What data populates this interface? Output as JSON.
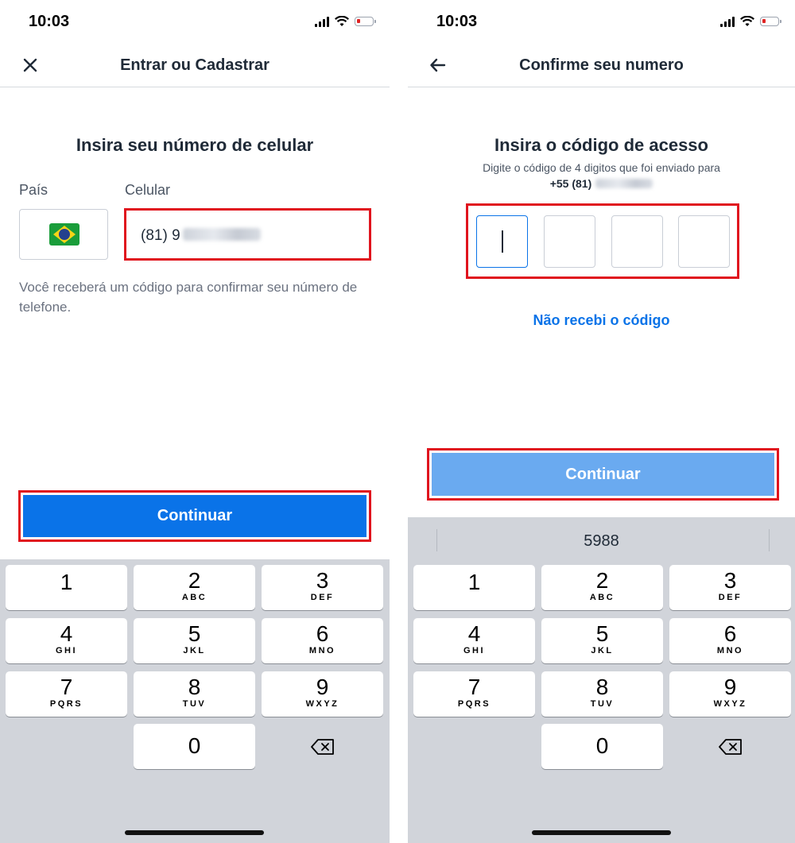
{
  "left_screen": {
    "status": {
      "time": "10:03"
    },
    "nav": {
      "title": "Entrar ou Cadastrar",
      "icon": "close-icon"
    },
    "heading": "Insira seu número de celular",
    "country_label": "País",
    "country_flag": "brazil-flag-icon",
    "phone_label": "Celular",
    "phone_value_visible": "(81) 9",
    "helper_text": "Você receberá um código para confirmar seu número de telefone.",
    "continue_label": "Continuar",
    "accent_color": "#0a73e8",
    "highlight_color": "#e0141e"
  },
  "right_screen": {
    "status": {
      "time": "10:03"
    },
    "nav": {
      "title": "Confirme seu numero",
      "icon": "back-arrow-icon"
    },
    "heading": "Insira o código de acesso",
    "subtext": "Digite o código de 4 digitos que foi enviado para",
    "phone_prefix": "+55 (81)",
    "code_boxes": [
      "",
      "",
      "",
      ""
    ],
    "resend_link": "Não recebi o código",
    "continue_label": "Continuar",
    "autofill_suggestion": "5988"
  },
  "keypad": {
    "keys": [
      {
        "num": "1",
        "letters": ""
      },
      {
        "num": "2",
        "letters": "ABC"
      },
      {
        "num": "3",
        "letters": "DEF"
      },
      {
        "num": "4",
        "letters": "GHI"
      },
      {
        "num": "5",
        "letters": "JKL"
      },
      {
        "num": "6",
        "letters": "MNO"
      },
      {
        "num": "7",
        "letters": "PQRS"
      },
      {
        "num": "8",
        "letters": "TUV"
      },
      {
        "num": "9",
        "letters": "WXYZ"
      },
      {
        "num": "0",
        "letters": ""
      }
    ],
    "backspace_icon": "backspace-icon"
  }
}
